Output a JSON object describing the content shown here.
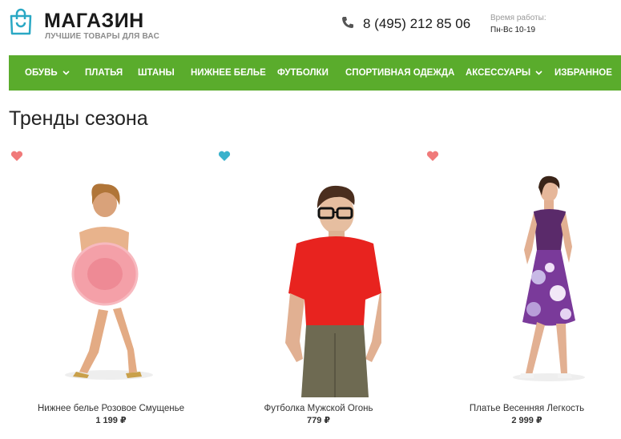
{
  "header": {
    "logo_title": "МАГАЗИН",
    "logo_subtitle": "ЛУЧШИЕ ТОВАРЫ ДЛЯ ВАС",
    "phone": "8 (495) 212 85 06",
    "hours_label": "Время работы:",
    "hours_value": "Пн-Вс 10-19",
    "accent_color": "#2aa8c4"
  },
  "nav": {
    "background": "#5aac2c",
    "items": [
      {
        "label": "ОБУВЬ",
        "dropdown": true
      },
      {
        "label": "ПЛАТЬЯ",
        "dropdown": false
      },
      {
        "label": "ШТАНЫ",
        "dropdown": false
      },
      {
        "label": "НИЖНЕЕ БЕЛЬЕ",
        "dropdown": false
      },
      {
        "label": "ФУТБОЛКИ",
        "dropdown": false
      },
      {
        "label": "СПОРТИВНАЯ ОДЕЖДА",
        "dropdown": false
      },
      {
        "label": "АКСЕССУАРЫ",
        "dropdown": true
      },
      {
        "label": "ИЗБРАННОЕ",
        "dropdown": false
      }
    ]
  },
  "section_title": "Тренды сезона",
  "products": [
    {
      "name": "Нижнее белье Розовое Смущенье",
      "price": "1 199 ₽",
      "favorite_color": "#f07a7a"
    },
    {
      "name": "Футболка Мужской Огонь",
      "price": "779 ₽",
      "favorite_color": "#3ab2cc"
    },
    {
      "name": "Платье Весенняя Легкость",
      "price": "2 999 ₽",
      "favorite_color": "#f07a7a"
    }
  ]
}
